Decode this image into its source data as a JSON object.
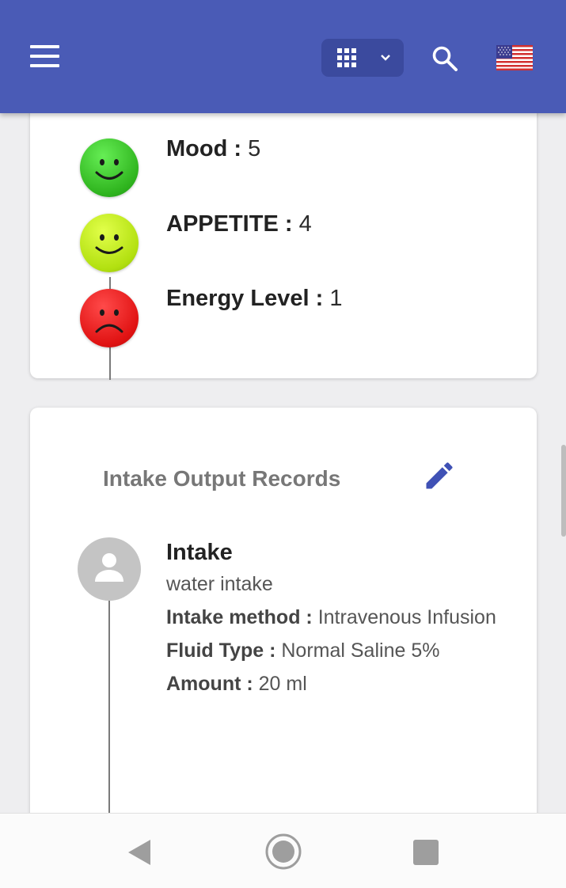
{
  "appbar": {
    "menu_icon": "hamburger-menu-icon",
    "apps_icon": "grid-apps-icon",
    "apps_dropdown_icon": "chevron-down-icon",
    "search_icon": "search-icon",
    "language_icon": "us-flag-icon",
    "accent_color": "#4a5bb6"
  },
  "mood_card": {
    "items": [
      {
        "label": "Mood",
        "separator": " : ",
        "value": "5",
        "face": "happy-face-icon",
        "color": "#3cc62a"
      },
      {
        "label": "APPETITE",
        "separator": " : ",
        "value": "4",
        "face": "happy-face-icon",
        "color": "#c4ec1c"
      },
      {
        "label": "Energy Level",
        "separator": " : ",
        "value": "1",
        "face": "sad-face-icon",
        "color": "#e41a1a"
      }
    ]
  },
  "intake_card": {
    "title": "Intake Output Records",
    "edit_icon": "pencil-edit-icon",
    "entry": {
      "avatar_icon": "person-avatar-icon",
      "title": "Intake",
      "description": "water intake",
      "method_label": "Intake method :",
      "method_value": "Intravenous Infusion",
      "fluid_label": "Fluid Type :",
      "fluid_value": "Normal Saline 5%",
      "amount_label": "Amount :",
      "amount_value": "20 ml"
    }
  },
  "navbar": {
    "back_icon": "back-triangle-icon",
    "home_icon": "home-circle-icon",
    "recents_icon": "recents-square-icon"
  }
}
